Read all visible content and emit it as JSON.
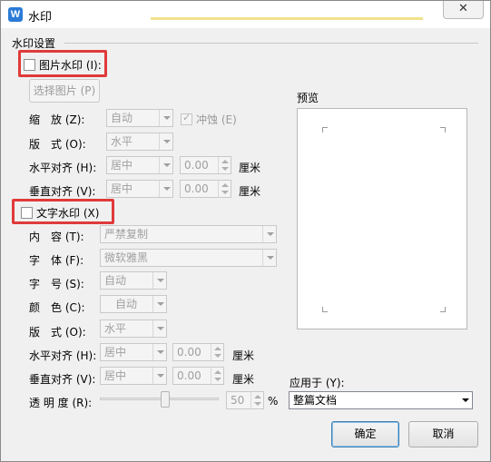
{
  "window": {
    "title": "水印",
    "close_symbol": "✕"
  },
  "group_title": "水印设置",
  "picture_watermark": {
    "checkbox_label": "图片水印 (I):",
    "choose_button": "选择图片 (P)",
    "scale": {
      "label": "缩　放 (Z):",
      "value": "自动"
    },
    "washout": {
      "label": "冲蚀 (E)",
      "checked": true
    },
    "layout": {
      "label": "版　式 (O):",
      "value": "水平"
    },
    "halign": {
      "label": "水平对齐 (H):",
      "value": "居中",
      "offset": "0.00",
      "unit": "厘米"
    },
    "valign": {
      "label": "垂直对齐 (V):",
      "value": "居中",
      "offset": "0.00",
      "unit": "厘米"
    }
  },
  "text_watermark": {
    "checkbox_label": "文字水印 (X)",
    "content": {
      "label": "内　容 (T):",
      "value": "严禁复制"
    },
    "font": {
      "label": "字　体 (F):",
      "value": "微软雅黑"
    },
    "size": {
      "label": "字　号 (S):",
      "value": "自动"
    },
    "color": {
      "label": "颜　色 (C):",
      "value": "自动"
    },
    "layout": {
      "label": "版　式 (O):",
      "value": "水平"
    },
    "halign": {
      "label": "水平对齐 (H):",
      "value": "居中",
      "offset": "0.00",
      "unit": "厘米"
    },
    "valign": {
      "label": "垂直对齐 (V):",
      "value": "居中",
      "offset": "0.00",
      "unit": "厘米"
    },
    "transparency": {
      "label": "透 明 度 (R):",
      "value": "50",
      "unit": "%",
      "fraction": 0.5
    }
  },
  "preview": {
    "label": "预览"
  },
  "apply_to": {
    "label": "应用于 (Y):",
    "value": "整篇文档"
  },
  "buttons": {
    "ok": "确定",
    "cancel": "取消"
  },
  "colors": {
    "highlight_border": "#e03a3a",
    "title_icon": "#2b7bd6",
    "primary_button_border": "#3c7fb1"
  }
}
